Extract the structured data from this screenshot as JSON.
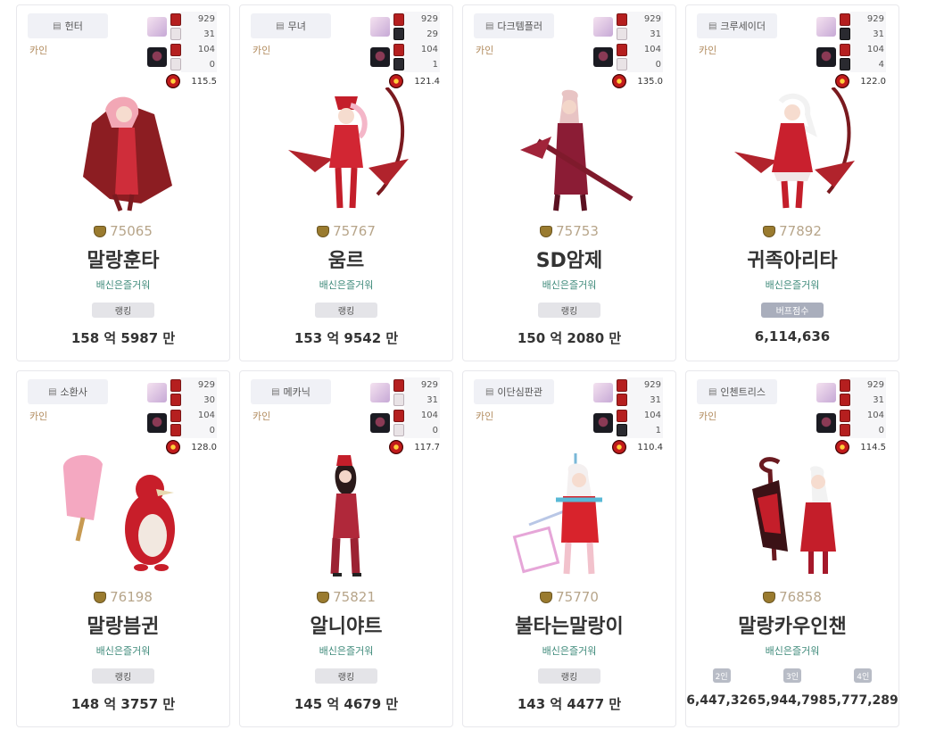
{
  "cards": [
    {
      "job": "헌터",
      "server": "카인",
      "stats": {
        "r1": [
          "929",
          "31"
        ],
        "r2": [
          "104",
          "0"
        ],
        "skill": "115.5"
      },
      "fame": "75065",
      "name": "말랑훈타",
      "guild": "배신은즐거워",
      "badge": "랭킹",
      "score": "158 억 5987 만"
    },
    {
      "job": "무녀",
      "server": "카인",
      "stats": {
        "r1": [
          "929",
          "29"
        ],
        "r2": [
          "104",
          "1"
        ],
        "skill": "121.4"
      },
      "fame": "75767",
      "name": "움르",
      "guild": "배신은즐거워",
      "badge": "랭킹",
      "score": "153 억 9542 만"
    },
    {
      "job": "다크템플러",
      "server": "카인",
      "stats": {
        "r1": [
          "929",
          "31"
        ],
        "r2": [
          "104",
          "0"
        ],
        "skill": "135.0"
      },
      "fame": "75753",
      "name": "SD암제",
      "guild": "배신은즐거워",
      "badge": "랭킹",
      "score": "150 억 2080 만"
    },
    {
      "job": "크루세이더",
      "server": "카인",
      "stats": {
        "r1": [
          "929",
          "31"
        ],
        "r2": [
          "104",
          "4"
        ],
        "skill": "122.0"
      },
      "fame": "77892",
      "name": "귀족아리타",
      "guild": "배신은즐거워",
      "badge": "버프점수",
      "score": "6,114,636"
    },
    {
      "job": "소환사",
      "server": "카인",
      "stats": {
        "r1": [
          "929",
          "30"
        ],
        "r2": [
          "104",
          "0"
        ],
        "skill": "128.0"
      },
      "fame": "76198",
      "name": "말랑븜귄",
      "guild": "배신은즐거워",
      "badge": "랭킹",
      "score": "148 억 3757 만"
    },
    {
      "job": "메카닉",
      "server": "카인",
      "stats": {
        "r1": [
          "929",
          "31"
        ],
        "r2": [
          "104",
          "0"
        ],
        "skill": "117.7"
      },
      "fame": "75821",
      "name": "알니야트",
      "guild": "배신은즐거워",
      "badge": "랭킹",
      "score": "145 억 4679 만"
    },
    {
      "job": "이단심판관",
      "server": "카인",
      "stats": {
        "r1": [
          "929",
          "31"
        ],
        "r2": [
          "104",
          "1"
        ],
        "skill": "110.4"
      },
      "fame": "75770",
      "name": "불타는말랑이",
      "guild": "배신은즐거워",
      "badge": "랭킹",
      "score": "143 억 4477 만"
    },
    {
      "job": "인첸트리스",
      "server": "카인",
      "stats": {
        "r1": [
          "929",
          "31"
        ],
        "r2": [
          "104",
          "0"
        ],
        "skill": "114.5"
      },
      "fame": "76858",
      "name": "말랑카우인챈",
      "guild": "배신은즐거워",
      "party": [
        {
          "label": "2인",
          "value": "6,447,326"
        },
        {
          "label": "3인",
          "value": "5,944,798"
        },
        {
          "label": "4인",
          "value": "5,777,289"
        }
      ]
    }
  ]
}
